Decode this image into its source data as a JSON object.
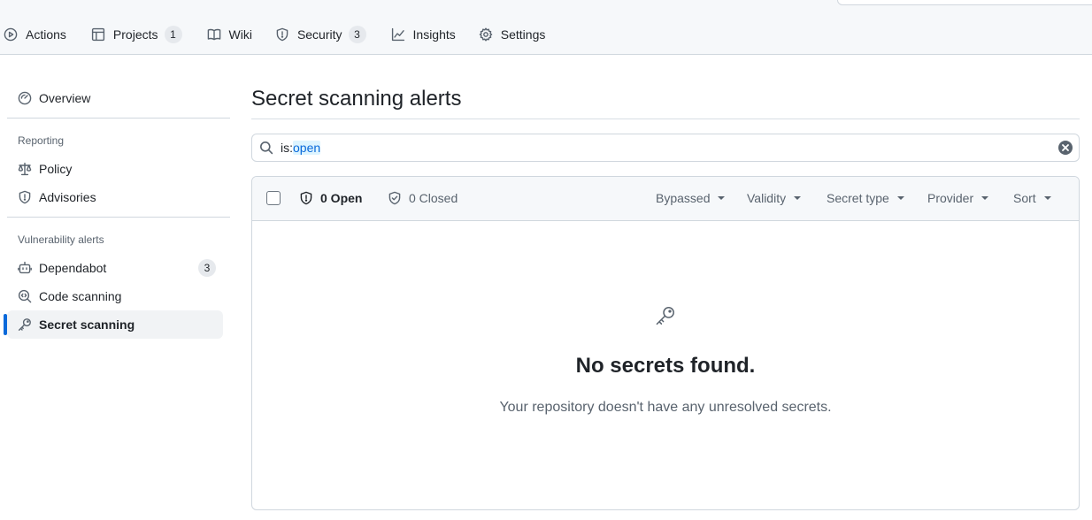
{
  "repo_nav": {
    "tabs": [
      {
        "label": "Actions",
        "icon": "play-icon"
      },
      {
        "label": "Projects",
        "icon": "table-icon",
        "count": "1"
      },
      {
        "label": "Wiki",
        "icon": "book-icon"
      },
      {
        "label": "Security",
        "icon": "shield-icon",
        "count": "3"
      },
      {
        "label": "Insights",
        "icon": "graph-icon"
      },
      {
        "label": "Settings",
        "icon": "gear-icon"
      }
    ]
  },
  "sidebar": {
    "overview": {
      "label": "Overview",
      "icon": "meter-icon"
    },
    "reporting_heading": "Reporting",
    "policy": {
      "label": "Policy",
      "icon": "law-icon"
    },
    "advisories": {
      "label": "Advisories",
      "icon": "shield-icon"
    },
    "vuln_heading": "Vulnerability alerts",
    "dependabot": {
      "label": "Dependabot",
      "icon": "dependabot-icon",
      "count": "3"
    },
    "code_scanning": {
      "label": "Code scanning",
      "icon": "codescan-icon"
    },
    "secret_scanning": {
      "label": "Secret scanning",
      "icon": "key-icon",
      "active": true
    }
  },
  "main": {
    "title": "Secret scanning alerts",
    "search": {
      "qualifier": "is:",
      "value": "open"
    },
    "states": {
      "open_label": "0 Open",
      "closed_label": "0 Closed"
    },
    "filters": {
      "bypassed": "Bypassed",
      "validity": "Validity",
      "secret_type": "Secret type",
      "provider": "Provider",
      "sort": "Sort"
    },
    "blankslate": {
      "icon": "key-icon",
      "heading": "No secrets found.",
      "description": "Your repository doesn't have any unresolved secrets."
    }
  },
  "colors": {
    "accent": "#0969da",
    "text": "#1f2328",
    "muted": "#59636e",
    "border": "#d0d7de",
    "subtle_bg": "#f6f8fa"
  }
}
